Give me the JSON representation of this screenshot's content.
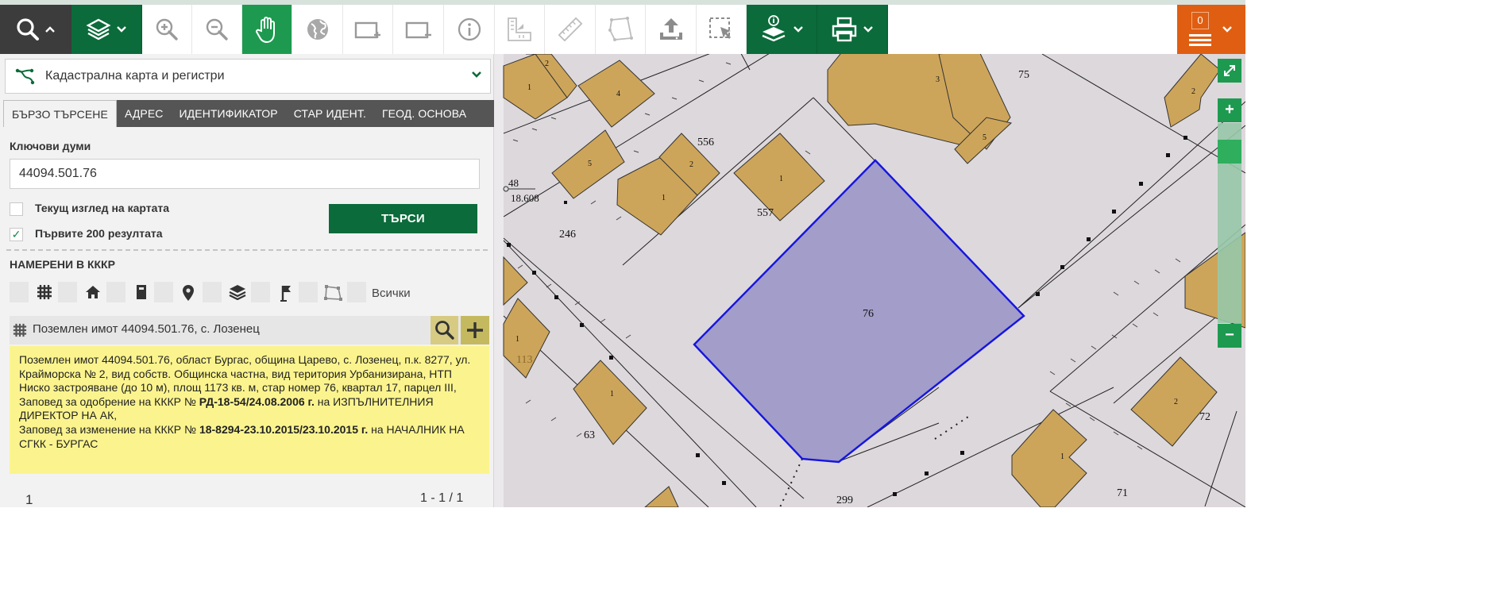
{
  "toolbar": {
    "tools": [
      "search-icon",
      "layers-icon",
      "zoom-in-icon",
      "zoom-out-icon",
      "pan-hand-icon",
      "globe-icon",
      "add-rect-icon",
      "remove-rect-icon",
      "info-icon",
      "coordinates-icon",
      "measure-icon",
      "area-icon",
      "upload-icon",
      "select-icon",
      "layer-info-icon",
      "print-icon"
    ],
    "notification_count": "0"
  },
  "panel": {
    "layer_name": "Кадастрална карта и регистри",
    "tabs": [
      "БЪРЗО ТЪРСЕНЕ",
      "АДРЕС",
      "ИДЕНТИФИКАТОР",
      "СТАР ИДЕНТ.",
      "ГЕОД. ОСНОВА"
    ],
    "active_tab": 0,
    "keywords_label": "Ключови думи",
    "keywords_value": "44094.501.76",
    "current_view_label": "Текущ изглед на картата",
    "current_view_checked": false,
    "first200_label": "Първите 200 резултата",
    "first200_checked": true,
    "check_mark": "✓",
    "search_button": "ТЪРСИ",
    "found_title": "НАМЕРЕНИ В КККР",
    "filter_icons": [
      "grid-icon",
      "house-icon",
      "building-icon",
      "pin-icon",
      "layers-icon",
      "flag-icon",
      "polygon-icon"
    ],
    "filter_all": "Всички",
    "result_title": "Поземлен имот 44094.501.76, с. Лозенец",
    "result_info": {
      "line1": "Поземлен имот 44094.501.76, област Бургас, община Царево, с. Лозенец, п.к. 8277, ул. Крайморска № 2, вид собств. Общинска частна, вид територия Урбанизирана, НТП Ниско застрояване (до 10 м), площ 1173 кв. м, стар номер 76, квартал 17, парцел III,",
      "order1_prefix": "Заповед за одобрение на КККР №",
      "order1_number": "РД-18-54/24.08.2006 г.",
      "order1_suffix": "на ИЗПЪЛНИТЕЛНИЯ ДИРЕКТОР НА АК,",
      "order2_prefix": "Заповед за изменение на КККР №",
      "order2_number": "18-8294-23.10.2015/23.10.2015 г.",
      "order2_suffix": "на НАЧАЛНИК НА СГКК - БУРГАС"
    },
    "page_current": "1",
    "page_range": "1 - 1 / 1"
  },
  "map": {
    "colors": {
      "background": "#ddd8dc",
      "building": "#cda55a",
      "selected_fill": "#a29dc9",
      "selected_stroke": "#1515e0"
    },
    "labels": {
      "parcel_75": "75",
      "parcel_76": "76",
      "parcel_556": "556",
      "parcel_557": "557",
      "parcel_246": "246",
      "parcel_63": "63",
      "parcel_72": "72",
      "parcel_71": "71",
      "parcel_299": "299",
      "parcel_113": "113",
      "point_num": "48",
      "point_elev": "18.608",
      "b1": "1",
      "b2": "2",
      "b3": "3",
      "b4": "4",
      "b5": "5"
    },
    "zoom_in": "+",
    "zoom_out": "−"
  }
}
